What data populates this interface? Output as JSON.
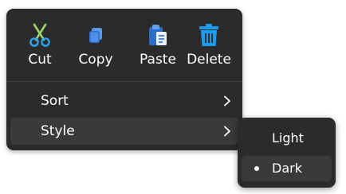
{
  "menu": {
    "actions": [
      {
        "label": "Cut",
        "icon": "scissors-icon"
      },
      {
        "label": "Copy",
        "icon": "copy-icon"
      },
      {
        "label": "Paste",
        "icon": "clipboard-paste-icon"
      },
      {
        "label": "Delete",
        "icon": "trash-icon"
      }
    ],
    "items": [
      {
        "label": "Sort",
        "has_submenu": true
      },
      {
        "label": "Style",
        "has_submenu": true,
        "highlighted": true
      }
    ]
  },
  "submenu": {
    "items": [
      {
        "label": "Light",
        "selected": false
      },
      {
        "label": "Dark",
        "selected": true
      }
    ]
  },
  "colors": {
    "menu_background": "#2b2b2b",
    "hover_background": "#3a3a3a",
    "accent_blue": "#1a9cf0",
    "text": "#ffffff"
  }
}
